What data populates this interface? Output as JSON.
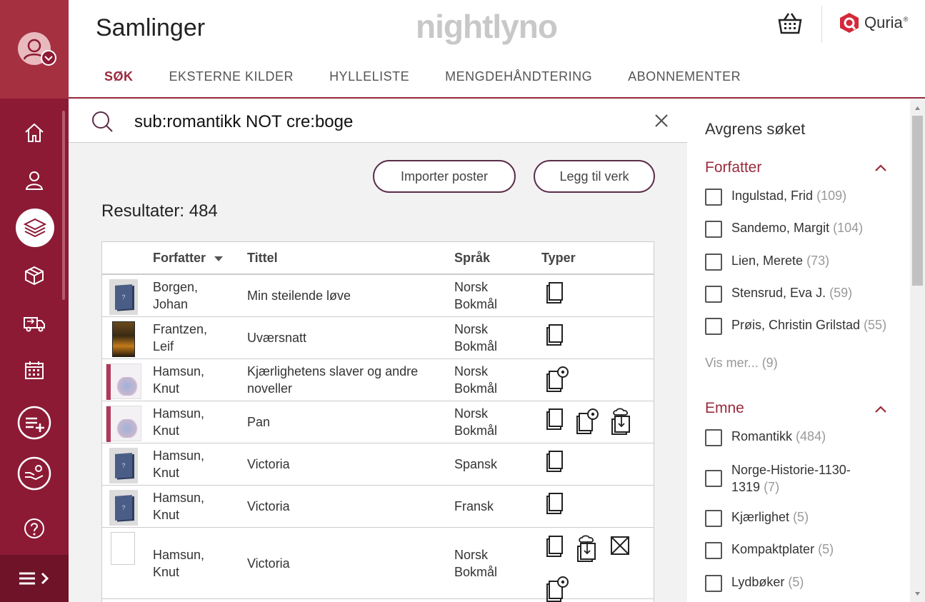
{
  "header": {
    "title": "Samlinger",
    "brand": "nightlyno",
    "vendor": "Quria",
    "vendor_mark": "®"
  },
  "tabs": [
    {
      "label": "SØK",
      "active": true
    },
    {
      "label": "EKSTERNE KILDER",
      "active": false
    },
    {
      "label": "HYLLELISTE",
      "active": false
    },
    {
      "label": "MENGDEHÅNDTERING",
      "active": false
    },
    {
      "label": "ABONNEMENTER",
      "active": false
    }
  ],
  "search": {
    "value": "sub:romantikk NOT cre:boge"
  },
  "actions": {
    "import_label": "Importer poster",
    "add_work_label": "Legg til verk"
  },
  "results": {
    "label": "Resultater: 484"
  },
  "table": {
    "headers": {
      "author": "Forfatter",
      "title": "Tittel",
      "language": "Språk",
      "types": "Typer"
    },
    "rows": [
      {
        "author": [
          "Borgen,",
          "Johan"
        ],
        "title": "Min steilende løve",
        "language": [
          "Norsk",
          "Bokmål"
        ],
        "types": [
          "book-icon"
        ],
        "cover": "placeholder"
      },
      {
        "author": [
          "Frantzen,",
          "Leif"
        ],
        "title": "Uværsnatt",
        "language": [
          "Norsk",
          "Bokmål"
        ],
        "types": [
          "book-icon"
        ],
        "cover": "dark"
      },
      {
        "author": [
          "Hamsun,",
          "Knut"
        ],
        "title": "Kjærlighetens slaver og andre noveller",
        "language": [
          "Norsk",
          "Bokmål"
        ],
        "types": [
          "audiobook-icon"
        ],
        "cover": "sketch"
      },
      {
        "author": [
          "Hamsun,",
          "Knut"
        ],
        "title": "Pan",
        "language": [
          "Norsk",
          "Bokmål"
        ],
        "types": [
          "book-icon",
          "audiobook-icon",
          "ebook-download-icon"
        ],
        "cover": "sketch"
      },
      {
        "author": [
          "Hamsun,",
          "Knut"
        ],
        "title": "Victoria",
        "language": [
          "Spansk"
        ],
        "types": [
          "book-icon"
        ],
        "cover": "placeholder"
      },
      {
        "author": [
          "Hamsun,",
          "Knut"
        ],
        "title": "Victoria",
        "language": [
          "Fransk"
        ],
        "types": [
          "book-icon"
        ],
        "cover": "placeholder"
      },
      {
        "author": [
          "Hamsun,",
          "Knut"
        ],
        "title": "Victoria",
        "language": [
          "Norsk",
          "Bokmål"
        ],
        "types": [
          "book-icon",
          "ebook-download-icon",
          "package-icon",
          "audiobook-icon"
        ],
        "cover": "white"
      }
    ]
  },
  "facets": {
    "heading": "Avgrens søket",
    "groups": [
      {
        "title": "Forfatter",
        "items": [
          {
            "label": "Ingulstad, Frid",
            "count": "(109)"
          },
          {
            "label": "Sandemo, Margit",
            "count": "(104)"
          },
          {
            "label": "Lien, Merete",
            "count": "(73)"
          },
          {
            "label": "Stensrud, Eva J.",
            "count": "(59)"
          },
          {
            "label": "Prøis, Christin Grilstad",
            "count": "(55)"
          }
        ],
        "more": "Vis mer... (9)"
      },
      {
        "title": "Emne",
        "items": [
          {
            "label": "Romantikk",
            "count": "(484)"
          },
          {
            "label": "Norge-Historie-1130-",
            "label2": "1319",
            "count": "(7)"
          },
          {
            "label": "Kjærlighet",
            "count": "(5)"
          },
          {
            "label": "Kompaktplater",
            "count": "(5)"
          },
          {
            "label": "Lydbøker",
            "count": "(5)"
          }
        ]
      }
    ]
  },
  "colors": {
    "sidebar": "#8c1a35",
    "accent": "#9a2a3c",
    "button_border": "#5b2c47"
  }
}
